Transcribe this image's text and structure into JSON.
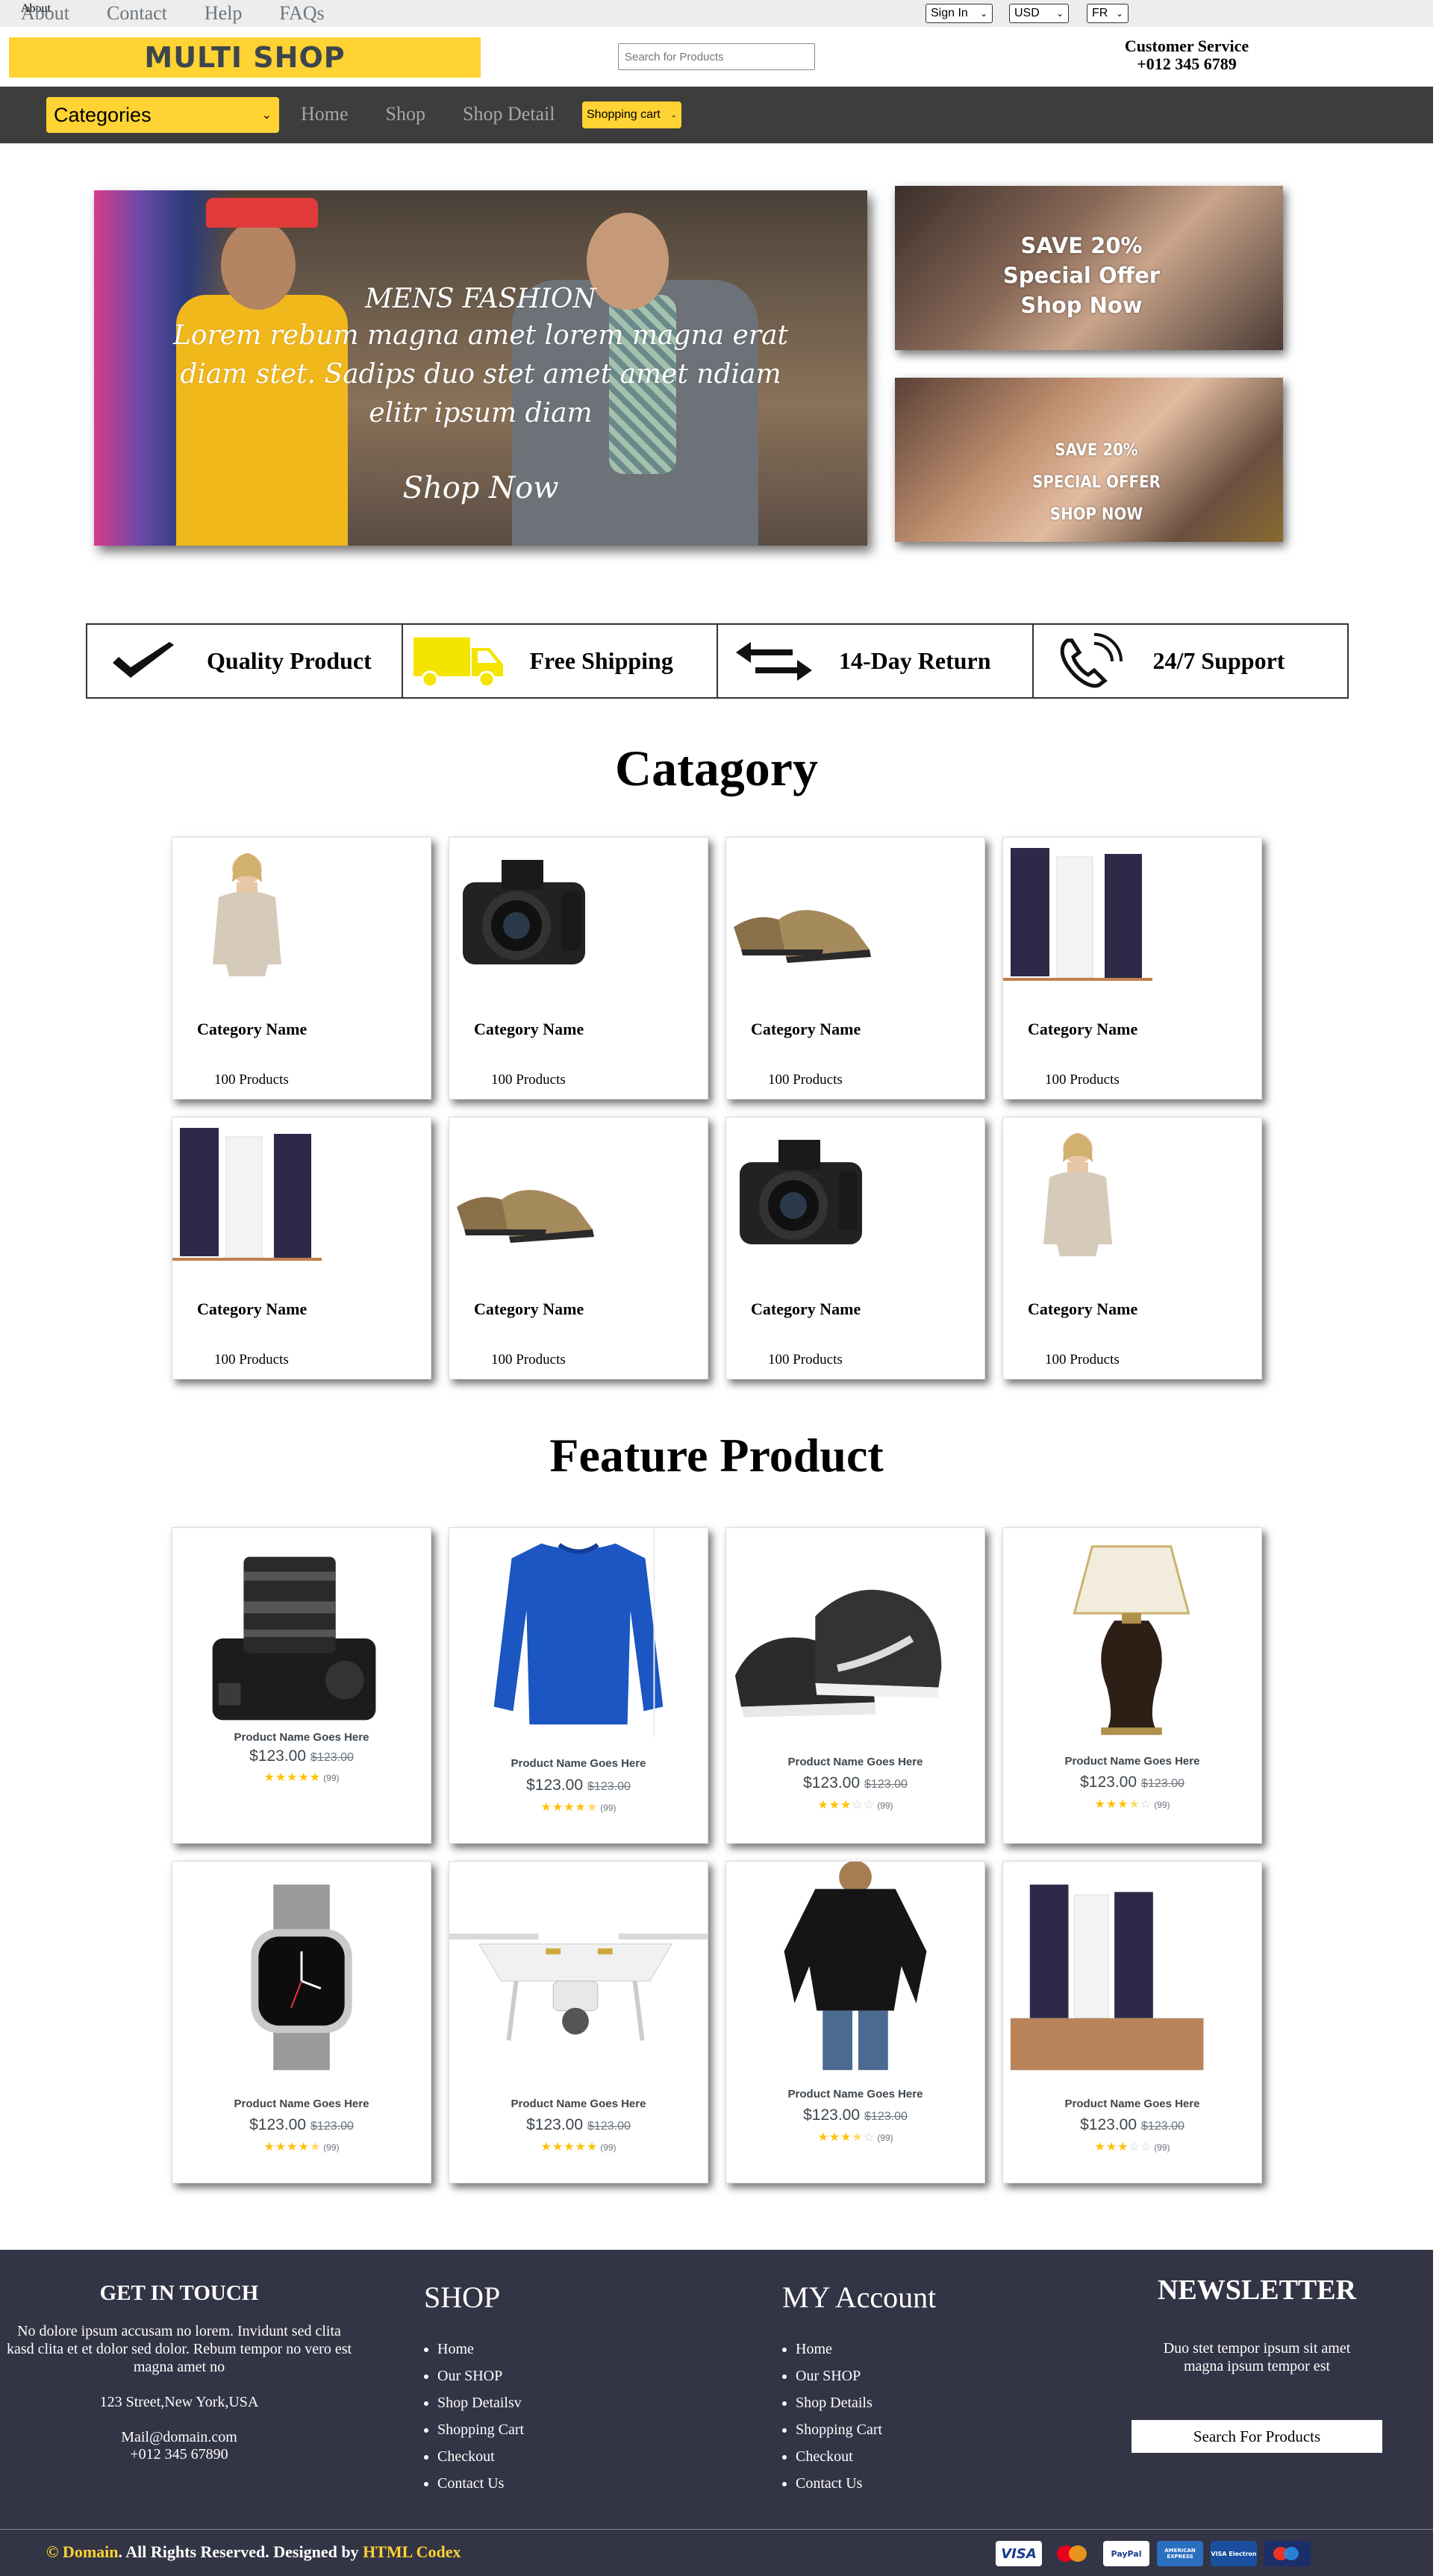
{
  "topbar": {
    "links": [
      "About",
      "Contact",
      "Help",
      "FAQs"
    ],
    "account_select": "Sign In",
    "currency_select": "USD",
    "language_select": "FR"
  },
  "header": {
    "logo": "MULTI SHOP",
    "search_placeholder": "Search for Products",
    "customer_service_label": "Customer Service",
    "customer_service_phone": "+012 345 6789"
  },
  "nav": {
    "categories_label": "Categories",
    "links": [
      "Home",
      "Shop",
      "Shop Detail"
    ],
    "cart_select": "Shopping cart"
  },
  "carousel": {
    "title": "MENS FASHION",
    "text": "Lorem rebum magna amet lorem magna erat diam stet. Sadips duo stet amet amet ndiam elitr ipsum diam",
    "button": "Shop Now"
  },
  "offers": [
    {
      "lines": [
        "SAVE 20%",
        "Special Offer",
        "Shop Now"
      ]
    },
    {
      "lines": [
        "SAVE 20%",
        "SPECIAL OFFER",
        "SHOP NOW"
      ]
    }
  ],
  "features": [
    {
      "icon": "check-icon",
      "label": "Quality Product"
    },
    {
      "icon": "truck-icon",
      "label": "Free Shipping"
    },
    {
      "icon": "exchange-icon",
      "label": "14-Day Return"
    },
    {
      "icon": "phone-icon",
      "label": "24/7 Support"
    }
  ],
  "category_section": {
    "title": "Catagory",
    "items": [
      {
        "image": "woman-sweater",
        "name": "Category Name",
        "count": "100 Products"
      },
      {
        "image": "camera",
        "name": "Category Name",
        "count": "100 Products"
      },
      {
        "image": "shoes",
        "name": "Category Name",
        "count": "100 Products"
      },
      {
        "image": "cosmetics",
        "name": "Category Name",
        "count": "100 Products"
      },
      {
        "image": "cosmetics",
        "name": "Category Name",
        "count": "100 Products"
      },
      {
        "image": "shoes",
        "name": "Category Name",
        "count": "100 Products"
      },
      {
        "image": "camera",
        "name": "Category Name",
        "count": "100 Products"
      },
      {
        "image": "woman-sweater",
        "name": "Category Name",
        "count": "100 Products"
      }
    ]
  },
  "featured_section": {
    "title": "Feature Product",
    "items": [
      {
        "image": "camera-lens",
        "name": "Product Name Goes Here",
        "price": "$123.00",
        "old_price": "$123.00",
        "rating": 5,
        "reviews": "(99)"
      },
      {
        "image": "blue-sweater",
        "name": "Product Name Goes Here",
        "price": "$123.00",
        "old_price": "$123.00",
        "rating": 4.5,
        "reviews": "(99)"
      },
      {
        "image": "sneakers",
        "name": "Product Name Goes Here",
        "price": "$123.00",
        "old_price": "$123.00",
        "rating": 3,
        "reviews": "(99)"
      },
      {
        "image": "lamp",
        "name": "Product Name Goes Here",
        "price": "$123.00",
        "old_price": "$123.00",
        "rating": 3.5,
        "reviews": "(99)"
      },
      {
        "image": "watch",
        "name": "Product Name Goes Here",
        "price": "$123.00",
        "old_price": "$123.00",
        "rating": 4.5,
        "reviews": "(99)"
      },
      {
        "image": "drone",
        "name": "Product Name Goes Here",
        "price": "$123.00",
        "old_price": "$123.00",
        "rating": 5,
        "reviews": "(99)"
      },
      {
        "image": "black-blouse",
        "name": "Product Name Goes Here",
        "price": "$123.00",
        "old_price": "$123.00",
        "rating": 3.5,
        "reviews": "(99)"
      },
      {
        "image": "cosmetics-box",
        "name": "Product Name Goes Here",
        "price": "$123.00",
        "old_price": "$123.00",
        "rating": 3,
        "reviews": "(99)"
      }
    ]
  },
  "footer": {
    "get_in_touch": {
      "title": "GET IN TOUCH",
      "text": "No dolore ipsum accusam no lorem. Invidunt sed clita kasd clita et et dolor sed dolor. Rebum tempor no vero est magna amet no",
      "address": "123 Street,New York,USA",
      "email": "Mail@domain.com",
      "phone": "+012 345 67890"
    },
    "shop": {
      "title": "SHOP",
      "links": [
        "Home",
        "Our SHOP",
        "Shop Detailsv",
        "Shopping Cart",
        "Checkout",
        "Contact Us"
      ]
    },
    "account": {
      "title": "MY Account",
      "links": [
        "Home",
        "Our SHOP",
        "Shop Details",
        "Shopping Cart",
        "Checkout",
        "Contact Us"
      ]
    },
    "newsletter": {
      "title": "NEWSLETTER",
      "text": "Duo stet tempor ipsum sit amet magna ipsum tempor est",
      "button": "Search For Products"
    },
    "copyright": {
      "domain": "© Domain",
      "middle": ". All Rights Reserved. Designed by ",
      "designer": "HTML Codex"
    },
    "payments": [
      "VISA",
      "mastercard",
      "PayPal",
      "AMERICAN EXPRESS",
      "VISA Electron",
      "Maestro"
    ]
  },
  "colors": {
    "accent": "#ffd333",
    "dark": "#3d3d3d",
    "footer": "#333445"
  }
}
